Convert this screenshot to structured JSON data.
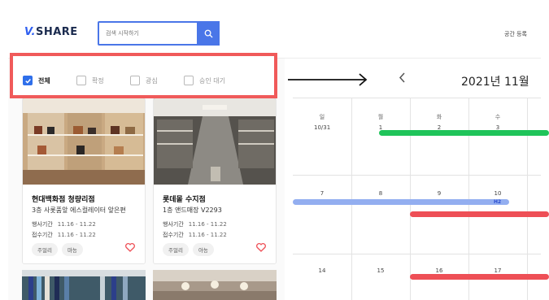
{
  "header": {
    "logo_mark": "V.",
    "logo_text": "SHARE",
    "search_placeholder": "검색 시작하기",
    "register_label": "공간 등록"
  },
  "filters": [
    {
      "label": "전체",
      "checked": true
    },
    {
      "label": "확정",
      "checked": false
    },
    {
      "label": "광심",
      "checked": false
    },
    {
      "label": "승인 대기",
      "checked": false
    }
  ],
  "cards": [
    {
      "title": "현대백화점 청량리점",
      "subtitle": "3층 사롯품앞 에스컬레이터 앞은편",
      "event_label": "행사기간",
      "event_dates": "11.16 - 11.22",
      "apply_label": "접수기간",
      "apply_dates": "11.16 - 11.22",
      "tags": [
        "주얼리",
        "마능"
      ]
    },
    {
      "title": "롯데몰 수지점",
      "subtitle": "1층 앤드매장 V2293",
      "event_label": "행사기간",
      "event_dates": "11.16 - 11.22",
      "apply_label": "접수기간",
      "apply_dates": "11.16 - 11.22",
      "tags": [
        "주얼리",
        "아능"
      ]
    }
  ],
  "calendar": {
    "month_label": "2021년 11월",
    "weekdays": [
      "일",
      "월",
      "화",
      "수"
    ],
    "weeks": [
      [
        "10/31",
        "1",
        "2",
        "3"
      ],
      [
        "7",
        "8",
        "9",
        "10"
      ],
      [
        "14",
        "15",
        "16",
        "17"
      ]
    ],
    "event_badge": "H2"
  },
  "colors": {
    "accent": "#4a76e8",
    "highlight_border": "#f05a5a",
    "green_bar": "#1fc45a",
    "red_bar": "#ee4f56",
    "blue_bar": "#93aef0",
    "heart": "#ee4f56"
  }
}
